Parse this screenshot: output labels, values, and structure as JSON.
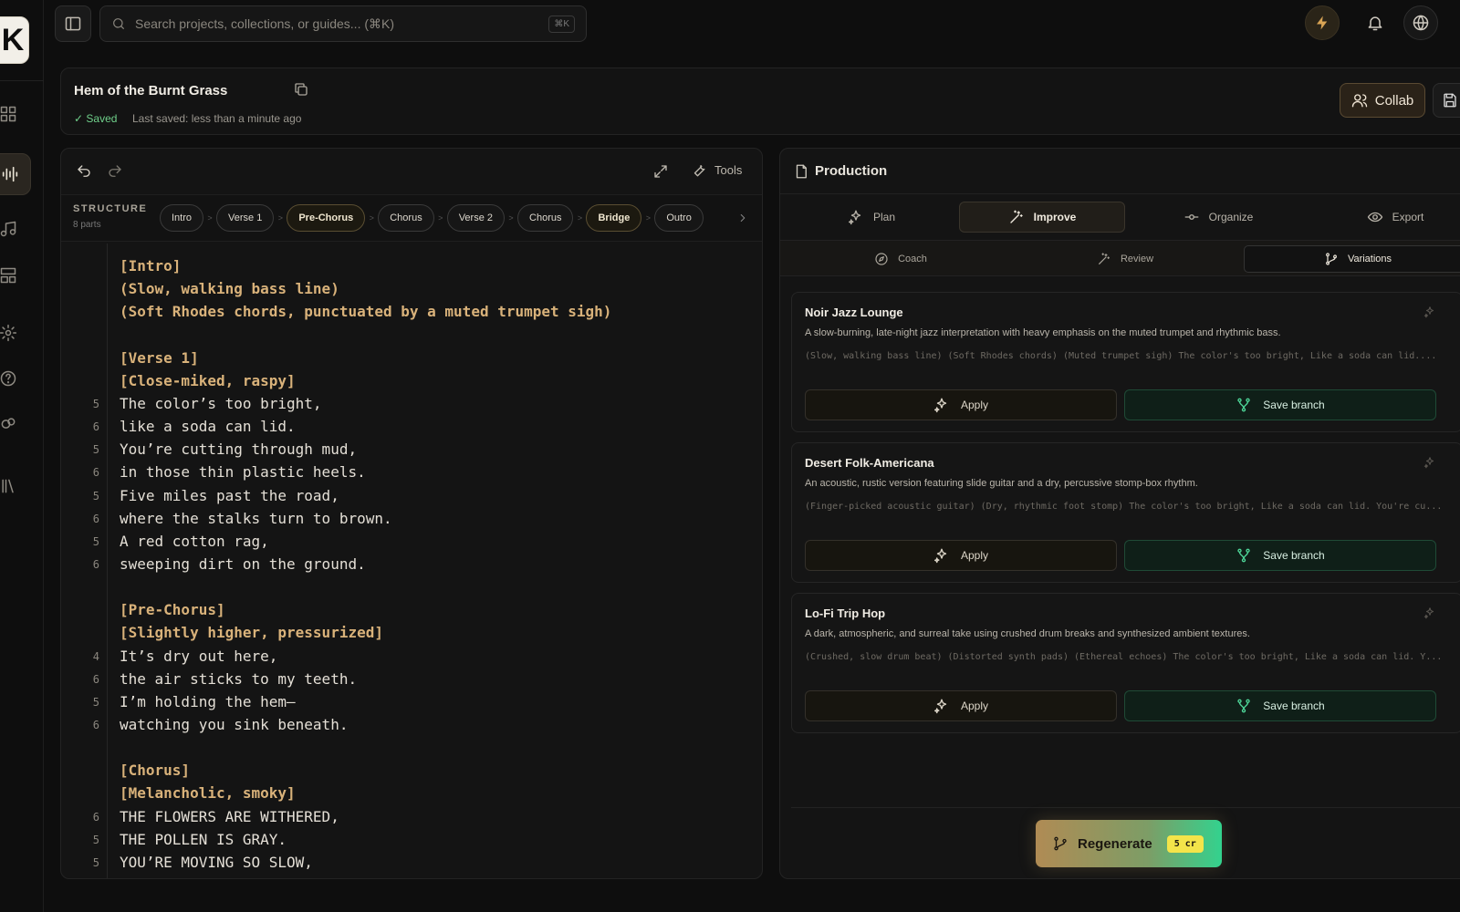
{
  "app": {
    "logo_letter": "K"
  },
  "search": {
    "placeholder": "Search projects, collections, or guides... (⌘K)",
    "shortcut": "⌘K"
  },
  "document": {
    "title": "Hem of the Burnt Grass",
    "saved": "✓ Saved",
    "last_saved": "Last saved: less than a minute ago"
  },
  "header": {
    "collab_label": "Collab"
  },
  "editor": {
    "tools_label": "Tools",
    "structure_label": "STRUCTURE",
    "structure_count": "8 parts",
    "sections": [
      {
        "label": "Intro",
        "highlight": false
      },
      {
        "label": "Verse 1",
        "highlight": false
      },
      {
        "label": "Pre-Chorus",
        "highlight": true
      },
      {
        "label": "Chorus",
        "highlight": false
      },
      {
        "label": "Verse 2",
        "highlight": false
      },
      {
        "label": "Chorus",
        "highlight": false
      },
      {
        "label": "Bridge",
        "highlight": true
      },
      {
        "label": "Outro",
        "highlight": false
      }
    ],
    "lines": [
      {
        "num": "",
        "text": "[Intro]",
        "tag": true
      },
      {
        "num": "",
        "text": "(Slow, walking bass line)",
        "tag": true
      },
      {
        "num": "",
        "text": "(Soft Rhodes chords, punctuated by a muted trumpet sigh)",
        "tag": true
      },
      {
        "num": "",
        "text": "",
        "tag": false
      },
      {
        "num": "",
        "text": "[Verse 1]",
        "tag": true
      },
      {
        "num": "",
        "text": "[Close-miked, raspy]",
        "tag": true
      },
      {
        "num": "5",
        "text": "The color’s too bright,",
        "tag": false
      },
      {
        "num": "6",
        "text": "like a soda can lid.",
        "tag": false
      },
      {
        "num": "5",
        "text": "You’re cutting through mud,",
        "tag": false
      },
      {
        "num": "6",
        "text": "in those thin plastic heels.",
        "tag": false
      },
      {
        "num": "5",
        "text": "Five miles past the road,",
        "tag": false
      },
      {
        "num": "6",
        "text": "where the stalks turn to brown.",
        "tag": false
      },
      {
        "num": "5",
        "text": "A red cotton rag,",
        "tag": false
      },
      {
        "num": "6",
        "text": "sweeping dirt on the ground.",
        "tag": false
      },
      {
        "num": "",
        "text": "",
        "tag": false
      },
      {
        "num": "",
        "text": "[Pre-Chorus]",
        "tag": true
      },
      {
        "num": "",
        "text": "[Slightly higher, pressurized]",
        "tag": true
      },
      {
        "num": "4",
        "text": "It’s dry out here,",
        "tag": false
      },
      {
        "num": "6",
        "text": "the air sticks to my teeth.",
        "tag": false
      },
      {
        "num": "5",
        "text": "I’m holding the hem—",
        "tag": false
      },
      {
        "num": "6",
        "text": "watching you sink beneath.",
        "tag": false
      },
      {
        "num": "",
        "text": "",
        "tag": false
      },
      {
        "num": "",
        "text": "[Chorus]",
        "tag": true
      },
      {
        "num": "",
        "text": "[Melancholic, smoky]",
        "tag": true
      },
      {
        "num": "6",
        "text": "THE FLOWERS ARE WITHERED,",
        "tag": false
      },
      {
        "num": "5",
        "text": "THE POLLEN IS GRAY.",
        "tag": false
      },
      {
        "num": "5",
        "text": "YOU’RE MOVING SO SLOW,",
        "tag": false
      }
    ]
  },
  "production": {
    "title": "Production",
    "tabs": [
      "Plan",
      "Improve",
      "Organize",
      "Export"
    ],
    "subtabs": [
      "Coach",
      "Review",
      "Variations"
    ],
    "apply_label": "Apply",
    "branch_label": "Save branch",
    "variations": [
      {
        "title": "Noir Jazz Lounge",
        "description": "A slow-burning, late-night jazz interpretation with heavy emphasis on the muted trumpet and rhythmic bass.",
        "preview": "(Slow, walking bass line) (Soft Rhodes chords) (Muted trumpet sigh) The color's too bright, Like a soda can lid...."
      },
      {
        "title": "Desert Folk-Americana",
        "description": "An acoustic, rustic version featuring slide guitar and a dry, percussive stomp-box rhythm.",
        "preview": "(Finger-picked acoustic guitar) (Dry, rhythmic foot stomp) The color's too bright, Like a soda can lid. You're cu..."
      },
      {
        "title": "Lo-Fi Trip Hop",
        "description": "A dark, atmospheric, and surreal take using crushed drum breaks and synthesized ambient textures.",
        "preview": "(Crushed, slow drum beat) (Distorted synth pads) (Ethereal echoes) The color's too bright, Like a soda can lid. Y..."
      }
    ],
    "regenerate_label": "Regenerate",
    "regenerate_cost": "5 cr"
  }
}
